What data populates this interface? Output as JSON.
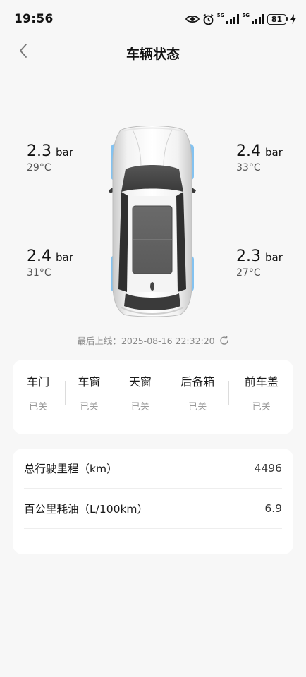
{
  "status_bar": {
    "time": "19:56",
    "signal1_label": "5G",
    "signal2_label": "5G",
    "battery": "81",
    "icons": [
      "eye-icon",
      "alarm-icon",
      "signal-icon",
      "signal-icon",
      "battery-icon",
      "charging-icon"
    ]
  },
  "nav": {
    "back_icon": "chevron-left-icon",
    "title": "车辆状态"
  },
  "tires": {
    "front_left": {
      "pressure": "2.3",
      "unit": "bar",
      "temp": "29°C"
    },
    "front_right": {
      "pressure": "2.4",
      "unit": "bar",
      "temp": "33°C"
    },
    "rear_left": {
      "pressure": "2.4",
      "unit": "bar",
      "temp": "31°C"
    },
    "rear_right": {
      "pressure": "2.3",
      "unit": "bar",
      "temp": "27°C"
    },
    "tire_highlight_color": "#6fb8ee"
  },
  "last_online": {
    "label": "最后上线：",
    "timestamp": "2025-08-16 22:32:20"
  },
  "vehicle_status": [
    {
      "label": "车门",
      "state": "已关"
    },
    {
      "label": "车窗",
      "state": "已关"
    },
    {
      "label": "天窗",
      "state": "已关"
    },
    {
      "label": "后备箱",
      "state": "已关"
    },
    {
      "label": "前车盖",
      "state": "已关"
    }
  ],
  "stats": [
    {
      "label": "总行驶里程（km）",
      "value": "4496"
    },
    {
      "label": "百公里耗油（L/100km）",
      "value": "6.9"
    }
  ]
}
